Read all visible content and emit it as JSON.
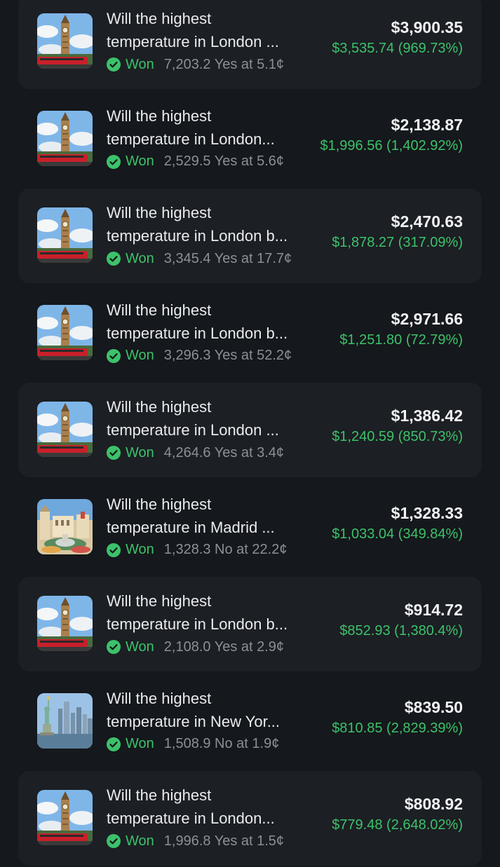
{
  "colors": {
    "background": "#15181c",
    "card": "#1c1f24",
    "won_green": "#3cc26a",
    "muted_text": "#8a9099"
  },
  "positions": [
    {
      "image": "london-big-ben-icon",
      "title_line1": "Will the highest",
      "title_line2": "temperature in London ...",
      "status": "Won",
      "detail": "7,203.2 Yes at 5.1¢",
      "value": "$3,900.35",
      "pnl": "$3,535.74 (969.73%)"
    },
    {
      "image": "london-big-ben-icon",
      "title_line1": "Will the highest",
      "title_line2": "temperature in London...",
      "status": "Won",
      "detail": "2,529.5 Yes at 5.6¢",
      "value": "$2,138.87",
      "pnl": "$1,996.56 (1,402.92%)"
    },
    {
      "image": "london-big-ben-icon",
      "title_line1": "Will the highest",
      "title_line2": "temperature in London b...",
      "status": "Won",
      "detail": "3,345.4 Yes at 17.7¢",
      "value": "$2,470.63",
      "pnl": "$1,878.27 (317.09%)"
    },
    {
      "image": "london-big-ben-icon",
      "title_line1": "Will the highest",
      "title_line2": "temperature in London b...",
      "status": "Won",
      "detail": "3,296.3 Yes at 52.2¢",
      "value": "$2,971.66",
      "pnl": "$1,251.80 (72.79%)"
    },
    {
      "image": "london-big-ben-icon",
      "title_line1": "Will the highest",
      "title_line2": "temperature in London ...",
      "status": "Won",
      "detail": "4,264.6 Yes at 3.4¢",
      "value": "$1,386.42",
      "pnl": "$1,240.59 (850.73%)"
    },
    {
      "image": "madrid-cibeles-icon",
      "title_line1": "Will the highest",
      "title_line2": "temperature in Madrid ...",
      "status": "Won",
      "detail": "1,328.3 No at 22.2¢",
      "value": "$1,328.33",
      "pnl": "$1,033.04 (349.84%)"
    },
    {
      "image": "london-big-ben-icon",
      "title_line1": "Will the highest",
      "title_line2": "temperature in London b...",
      "status": "Won",
      "detail": "2,108.0 Yes at 2.9¢",
      "value": "$914.72",
      "pnl": "$852.93 (1,380.4%)"
    },
    {
      "image": "new-york-statue-of-liberty-icon",
      "title_line1": "Will the highest",
      "title_line2": "temperature in New Yor...",
      "status": "Won",
      "detail": "1,508.9 No at 1.9¢",
      "value": "$839.50",
      "pnl": "$810.85 (2,829.39%)"
    },
    {
      "image": "london-big-ben-icon",
      "title_line1": "Will the highest",
      "title_line2": "temperature in London...",
      "status": "Won",
      "detail": "1,996.8 Yes at 1.5¢",
      "value": "$808.92",
      "pnl": "$779.48 (2,648.02%)"
    }
  ]
}
